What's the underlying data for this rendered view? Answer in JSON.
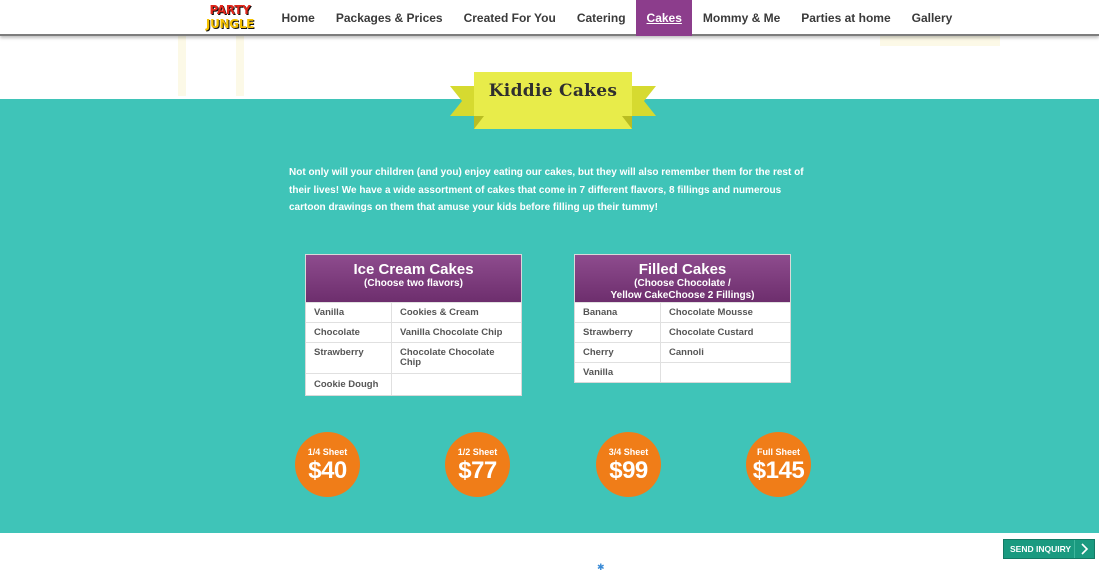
{
  "nav": {
    "logo": {
      "line1": "PARTY",
      "line2": "JUNGLE"
    },
    "items": [
      "Home",
      "Packages & Prices",
      "Created For You",
      "Catering",
      "Cakes",
      "Mommy & Me",
      "Parties at home",
      "Gallery"
    ],
    "active": "Cakes"
  },
  "banner": {
    "title": "Kiddie Cakes"
  },
  "intro": "Not only will your children (and you) enjoy eating our cakes, but they will also remember them for the rest of their lives! We have a wide assortment of cakes that come in 7 different flavors, 8 fillings and numerous cartoon drawings on them that amuse your kids before filling up their tummy!",
  "ice_cream": {
    "title": "Ice Cream Cakes",
    "subtitle": "(Choose two flavors)",
    "rows": [
      [
        "Vanilla",
        "Cookies & Cream"
      ],
      [
        "Chocolate",
        "Vanilla Chocolate Chip"
      ],
      [
        "Strawberry",
        "Chocolate Chocolate Chip"
      ],
      [
        "Cookie Dough",
        ""
      ]
    ]
  },
  "filled": {
    "title": "Filled Cakes",
    "subtitle_line1": "(Choose Chocolate /",
    "subtitle_line2": "Yellow CakeChoose 2 Fillings)",
    "rows": [
      [
        "Banana",
        "Chocolate Mousse"
      ],
      [
        "Strawberry",
        "Chocolate Custard"
      ],
      [
        "Cherry",
        "Cannoli"
      ],
      [
        "Vanilla",
        ""
      ]
    ]
  },
  "prices": [
    {
      "label": "1/4 Sheet",
      "value": "$40"
    },
    {
      "label": "1/2 Sheet",
      "value": "$77"
    },
    {
      "label": "3/4 Sheet",
      "value": "$99"
    },
    {
      "label": "Full Sheet",
      "value": "$145"
    }
  ],
  "inquiry": {
    "label": "SEND INQUIRY"
  },
  "colors": {
    "teal": "#3fc4b8",
    "purple": "#8c3d8c",
    "orange": "#f07d18",
    "banner_yellow": "#e8ec4a",
    "inquiry_green": "#1a9a80"
  }
}
